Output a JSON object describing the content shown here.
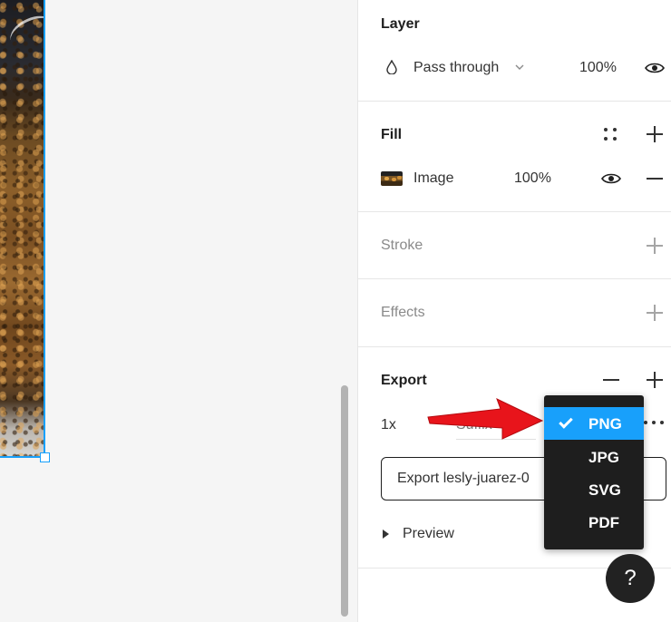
{
  "layer": {
    "title": "Layer",
    "blend_mode": "Pass through",
    "opacity": "100%"
  },
  "fill": {
    "title": "Fill",
    "type": "Image",
    "opacity": "100%"
  },
  "stroke": {
    "title": "Stroke"
  },
  "effects": {
    "title": "Effects"
  },
  "export": {
    "title": "Export",
    "scale": "1x",
    "suffix_placeholder": "Suffix",
    "button_label": "Export lesly-juarez-0",
    "preview_label": "Preview"
  },
  "format_dropdown": {
    "selected": "PNG",
    "options": [
      "PNG",
      "JPG",
      "SVG",
      "PDF"
    ]
  },
  "help": {
    "label": "?"
  },
  "colors": {
    "accent": "#18a0fb",
    "dropdown_bg": "#1e1e1e",
    "arrow": "#e8141b"
  },
  "icons": [
    "drop-icon",
    "chevron-down-icon",
    "eye-icon",
    "style-grid-icon",
    "plus-icon",
    "minus-icon",
    "more-icon",
    "check-icon",
    "triangle-right-icon",
    "arrow-annotation"
  ]
}
